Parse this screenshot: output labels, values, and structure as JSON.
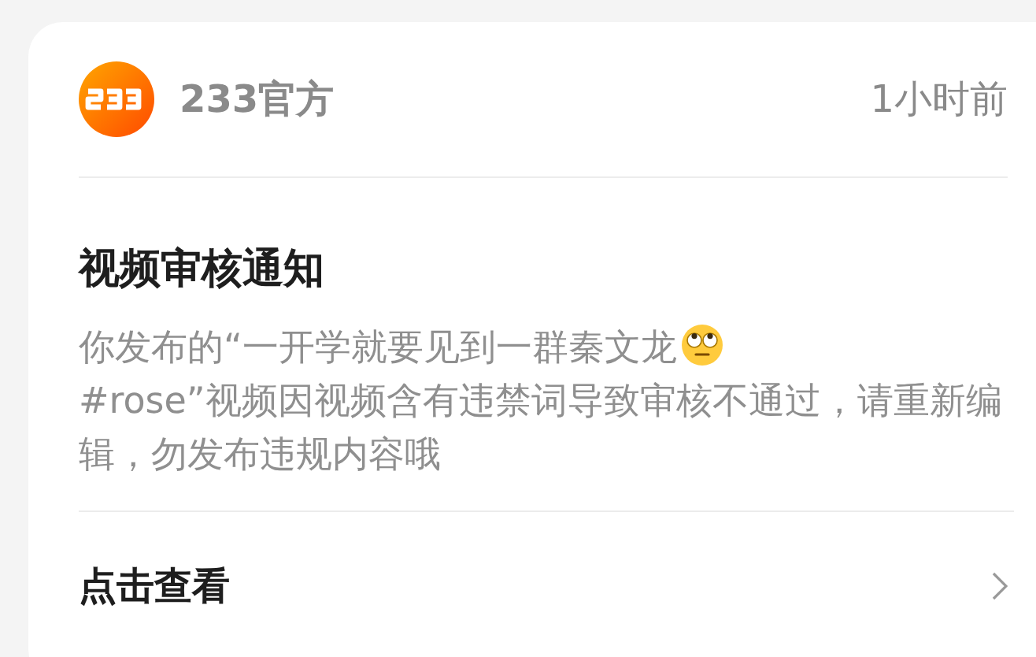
{
  "sender": {
    "name": "233官方",
    "time": "1小时前"
  },
  "title": "视频审核通知",
  "message": {
    "before_emoji": "你发布的“一开学就要见到一群秦文龙",
    "after_emoji": "#rose”视频因视频含有违禁词导致审核不通过，请重新编辑，勿发布违规内容哦"
  },
  "action": {
    "label": "点击查看"
  }
}
